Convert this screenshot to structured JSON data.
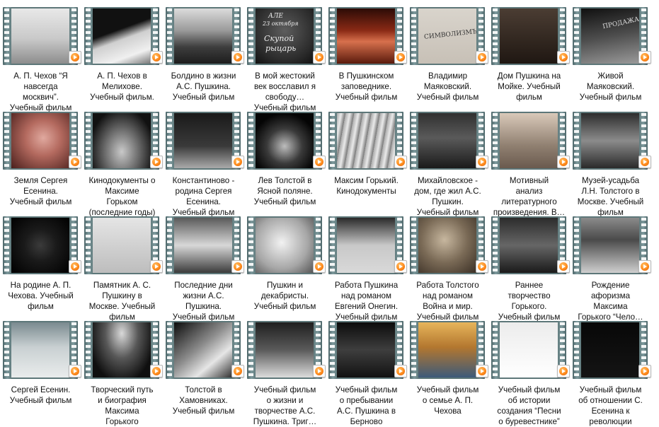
{
  "items": [
    {
      "l1": "А. П. Чехов “Я",
      "l2": "навсегда",
      "l3": "москвич”.",
      "l4": "Учебный фильм"
    },
    {
      "l1": "А. П. Чехов в",
      "l2": "Мелихове.",
      "l3": "Учебный фильм.",
      "l4": ""
    },
    {
      "l1": "Болдино в жизни",
      "l2": "А.С. Пушкина.",
      "l3": "Учебный фильм",
      "l4": ""
    },
    {
      "l1": "В мой жестокий",
      "l2": "век восславил я",
      "l3": "свободу…",
      "l4": "Учебный фильм"
    },
    {
      "l1": "В Пушкинском",
      "l2": "заповеднике.",
      "l3": "Учебный фильм",
      "l4": ""
    },
    {
      "l1": "Владимир",
      "l2": "Маяковский.",
      "l3": "Учебный фильм",
      "l4": ""
    },
    {
      "l1": "Дом Пушкина на",
      "l2": "Мойке. Учебный",
      "l3": "фильм",
      "l4": ""
    },
    {
      "l1": "Живой",
      "l2": "Маяковский.",
      "l3": "Учебный фильм",
      "l4": ""
    },
    {
      "l1": "Земля Сергея",
      "l2": "Есенина.",
      "l3": "Учебный фильм",
      "l4": ""
    },
    {
      "l1": "Кинодокументы о",
      "l2": "Максиме",
      "l3": "Горьком",
      "l4": "(последние годы)"
    },
    {
      "l1": "Константиново -",
      "l2": "родина Сергея",
      "l3": "Есенина.",
      "l4": "Учебный фильм"
    },
    {
      "l1": "Лев Толстой в",
      "l2": "Ясной поляне.",
      "l3": "Учебный фильм",
      "l4": ""
    },
    {
      "l1": "Максим Горький.",
      "l2": "Кинодокументы",
      "l3": "",
      "l4": ""
    },
    {
      "l1": "Михайловское -",
      "l2": "дом, где жил А.С.",
      "l3": "Пушкин.",
      "l4": "Учебный фильм"
    },
    {
      "l1": "Мотивный",
      "l2": "анализ",
      "l3": "литературного",
      "l4": "произведения. В…"
    },
    {
      "l1": "Музей-усадьба",
      "l2": "Л.Н. Толстого в",
      "l3": "Москве. Учебный",
      "l4": "фильм"
    },
    {
      "l1": "На родине А. П.",
      "l2": "Чехова. Учебный",
      "l3": "фильм",
      "l4": ""
    },
    {
      "l1": "Памятник  А. С.",
      "l2": "Пушкину в",
      "l3": "Москве. Учебный",
      "l4": "фильм"
    },
    {
      "l1": "Последние дни",
      "l2": "жизни А.С.",
      "l3": "Пушкина.",
      "l4": "Учебный фильм"
    },
    {
      "l1": "Пушкин и",
      "l2": "декабристы.",
      "l3": "Учебный фильм",
      "l4": ""
    },
    {
      "l1": "Работа Пушкина",
      "l2": "над романом",
      "l3": "Евгений Онегин.",
      "l4": "Учебный фильм"
    },
    {
      "l1": "Работа Толстого",
      "l2": "над романом",
      "l3": "Война и мир.",
      "l4": "Учебный фильм"
    },
    {
      "l1": "Раннее",
      "l2": "творчество",
      "l3": "Горького.",
      "l4": "Учебный фильм"
    },
    {
      "l1": "Рождение",
      "l2": "афоризма",
      "l3": "Максима",
      "l4": "Горького  “Чело…"
    },
    {
      "l1": "Сергей Есенин.",
      "l2": "Учебный фильм",
      "l3": "",
      "l4": ""
    },
    {
      "l1": "Творческий путь",
      "l2": "и биография",
      "l3": "Максима",
      "l4": "Горького"
    },
    {
      "l1": "Толстой в",
      "l2": "Хамовниках.",
      "l3": "Учебный фильм",
      "l4": ""
    },
    {
      "l1": "Учебный фильм",
      "l2": "о жизни и",
      "l3": "творчестве А.С.",
      "l4": "Пушкина. Триг…"
    },
    {
      "l1": "Учебный фильм",
      "l2": "о пребывании",
      "l3": "А.С. Пушкина в",
      "l4": "Берново"
    },
    {
      "l1": "Учебный фильм",
      "l2": "о семье А. П.",
      "l3": "Чехова",
      "l4": ""
    },
    {
      "l1": "Учебный фильм",
      "l2": "об истории",
      "l3": "создания “Песни",
      "l4": "о буревестнике”"
    },
    {
      "l1": "Учебный фильм",
      "l2": "об отношении С.",
      "l3": "Есенина к",
      "l4": "революции"
    }
  ],
  "thumb_texts": {
    "t3_a": "АЛЕ",
    "t3_b": "23 октября",
    "t3_c": "Скупой",
    "t3_d": "рыцарь",
    "t5": "СИМВОЛИЗМЪ",
    "t7": "ПРОДАЖА"
  },
  "colors": {
    "play_orange": "#ff8a1c",
    "film_frame": "#6f8a8c"
  }
}
